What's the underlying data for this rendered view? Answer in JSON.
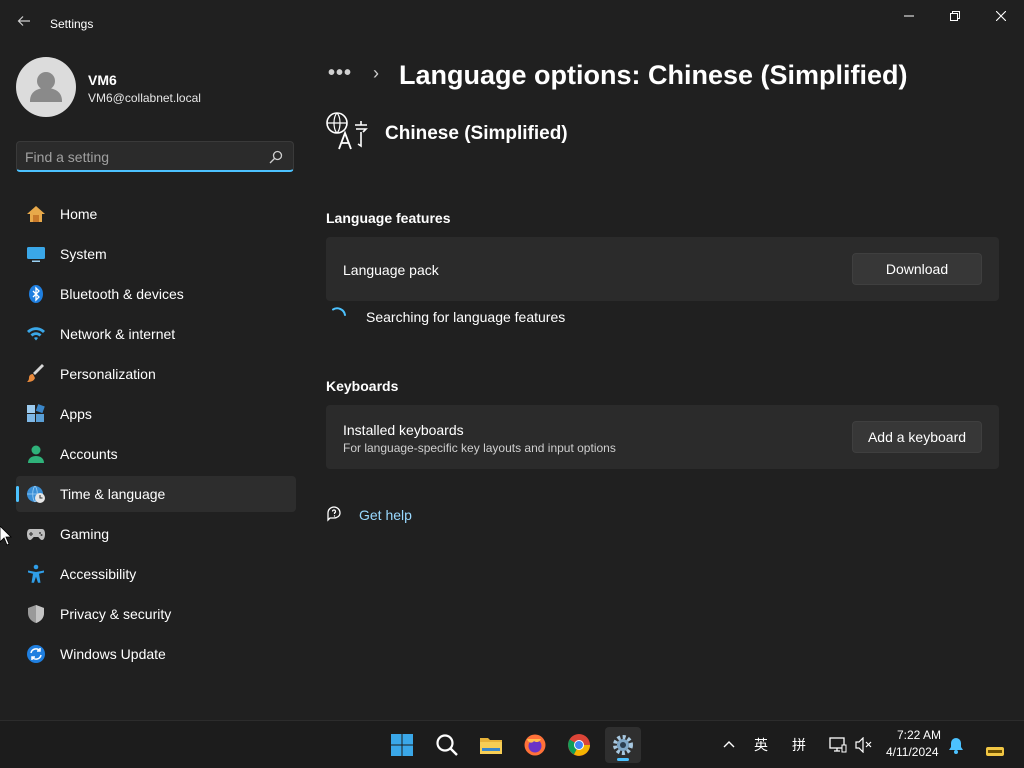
{
  "window": {
    "title": "Settings"
  },
  "user": {
    "name": "VM6",
    "email": "VM6@collabnet.local"
  },
  "search": {
    "placeholder": "Find a setting",
    "value": ""
  },
  "sidebar": {
    "selected": "Time & language",
    "items": [
      {
        "label": "Home",
        "icon": "home-icon"
      },
      {
        "label": "System",
        "icon": "system-icon"
      },
      {
        "label": "Bluetooth & devices",
        "icon": "bluetooth-icon"
      },
      {
        "label": "Network & internet",
        "icon": "wifi-icon"
      },
      {
        "label": "Personalization",
        "icon": "brush-icon"
      },
      {
        "label": "Apps",
        "icon": "apps-icon"
      },
      {
        "label": "Accounts",
        "icon": "accounts-icon"
      },
      {
        "label": "Time & language",
        "icon": "time-language-icon"
      },
      {
        "label": "Gaming",
        "icon": "gamepad-icon"
      },
      {
        "label": "Accessibility",
        "icon": "accessibility-icon"
      },
      {
        "label": "Privacy & security",
        "icon": "shield-icon"
      },
      {
        "label": "Windows Update",
        "icon": "update-icon"
      }
    ]
  },
  "breadcrumb": {
    "more": "•••",
    "separator": "›",
    "title": "Language options: Chinese (Simplified)"
  },
  "language": {
    "name": "Chinese (Simplified)"
  },
  "features": {
    "section_title": "Language features",
    "pack_label": "Language pack",
    "download_label": "Download",
    "searching_text": "Searching for language features"
  },
  "keyboards": {
    "section_title": "Keyboards",
    "installed_label": "Installed keyboards",
    "installed_sub": "For language-specific key layouts and input options",
    "add_label": "Add a keyboard"
  },
  "help": {
    "label": "Get help"
  },
  "taskbar": {
    "apps": [
      "start-icon",
      "search-icon",
      "file-explorer-icon",
      "firefox-icon",
      "chrome-icon",
      "settings-icon"
    ],
    "tray": {
      "chevron": "^",
      "ime_mode": "英",
      "ime_method": "拼"
    },
    "clock": {
      "time": "7:22 AM",
      "date": "4/11/2024"
    }
  },
  "colors": {
    "accent": "#4cc2ff",
    "background": "#202020",
    "card": "#2b2b2b",
    "link": "#99d9ff"
  }
}
